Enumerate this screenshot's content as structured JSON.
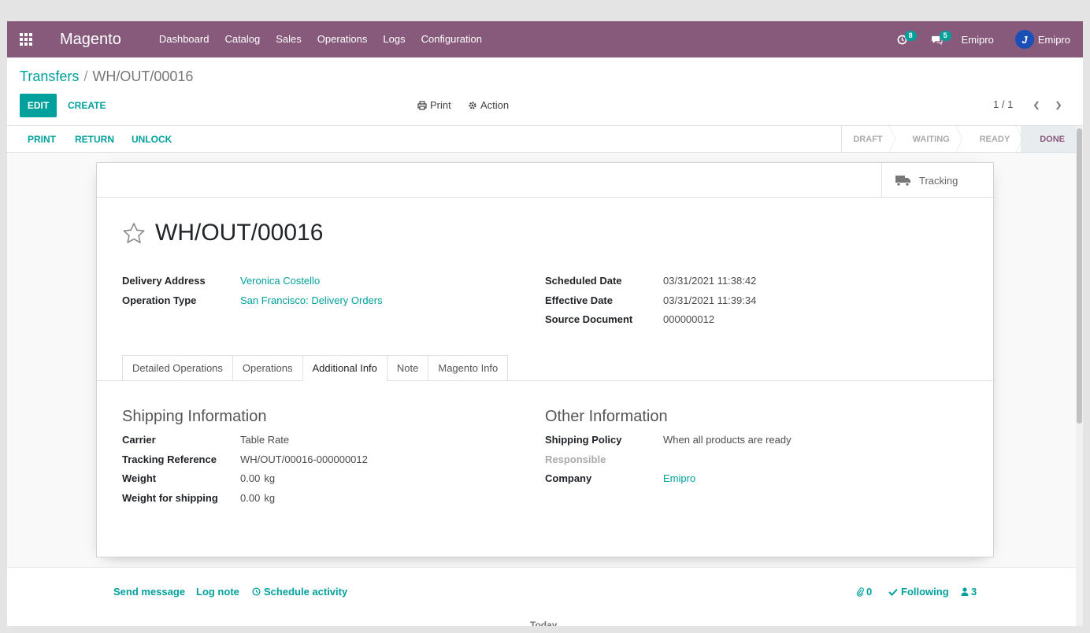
{
  "navbar": {
    "brand": "Magento",
    "menu": [
      "Dashboard",
      "Catalog",
      "Sales",
      "Operations",
      "Logs",
      "Configuration"
    ],
    "activity_count": "8",
    "message_count": "5",
    "company": "Emipro",
    "user": "Emipro",
    "color": "#875a7b"
  },
  "breadcrumb": {
    "parent": "Transfers",
    "separator": "/",
    "current": "WH/OUT/00016"
  },
  "control_panel": {
    "edit_label": "EDIT",
    "create_label": "CREATE",
    "print_label": "Print",
    "action_label": "Action",
    "pager": "1 / 1"
  },
  "statusbar": {
    "buttons": [
      "PRINT",
      "RETURN",
      "UNLOCK"
    ],
    "stages": [
      "DRAFT",
      "WAITING",
      "READY",
      "DONE"
    ],
    "active_stage": "DONE"
  },
  "sheet": {
    "tracking_label": "Tracking",
    "name": "WH/OUT/00016",
    "left_fields": [
      {
        "label": "Delivery Address",
        "value": "Veronica Costello"
      },
      {
        "label": "Operation Type",
        "value": "San Francisco: Delivery Orders"
      }
    ],
    "right_fields": [
      {
        "label": "Scheduled Date",
        "value": "03/31/2021 11:38:42"
      },
      {
        "label": "Effective Date",
        "value": "03/31/2021 11:39:34"
      },
      {
        "label": "Source Document",
        "value": "000000012"
      }
    ],
    "tabs": [
      "Detailed Operations",
      "Operations",
      "Additional Info",
      "Note",
      "Magento Info"
    ],
    "active_tab": "Additional Info",
    "shipping": {
      "title": "Shipping Information",
      "fields": [
        {
          "label": "Carrier",
          "value": "Table Rate"
        },
        {
          "label": "Tracking Reference",
          "value": "WH/OUT/00016-000000012"
        },
        {
          "label": "Weight",
          "value": "0.00",
          "unit": "kg"
        },
        {
          "label": "Weight for shipping",
          "value": "0.00",
          "unit": "kg"
        }
      ]
    },
    "other": {
      "title": "Other Information",
      "fields": [
        {
          "label": "Shipping Policy",
          "value": "When all products are ready"
        },
        {
          "label": "Responsible",
          "value": ""
        },
        {
          "label": "Company",
          "value": "Emipro"
        }
      ]
    }
  },
  "chatter": {
    "send_message": "Send message",
    "log_note": "Log note",
    "schedule_activity": "Schedule activity",
    "attachments": "0",
    "following": "Following",
    "followers": "3",
    "today": "Today"
  },
  "colors": {
    "primary": "#00a09d",
    "brand": "#875a7b"
  },
  "icons": [
    "apps-grid-icon",
    "clock-icon",
    "comments-icon",
    "print-icon",
    "gear-icon",
    "chevron-left-icon",
    "chevron-right-icon",
    "truck-icon",
    "star-icon",
    "paperclip-icon",
    "check-icon",
    "user-icon"
  ]
}
